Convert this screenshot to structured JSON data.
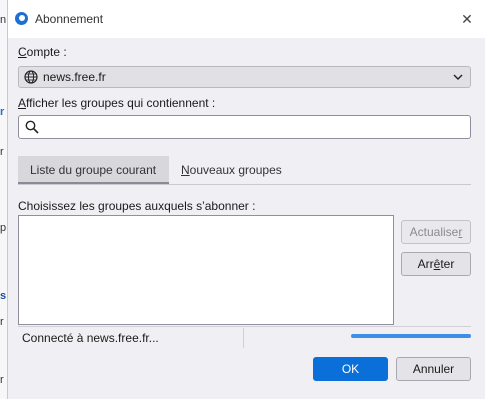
{
  "background_app": {
    "edge_chars": [
      "n",
      "r",
      "r",
      "p",
      "s",
      "r",
      "r"
    ]
  },
  "dialog": {
    "title": "Abonnement",
    "close_glyph": "✕"
  },
  "account": {
    "label": "Compte :",
    "selected": "news.free.fr"
  },
  "filter": {
    "label": "Afficher les groupes qui contiennent :",
    "value": "",
    "placeholder": ""
  },
  "tabs": [
    {
      "label": "Liste du groupe courant",
      "selected": true
    },
    {
      "label": "Nouveaux groupes",
      "selected": false
    }
  ],
  "list": {
    "label": "Choisissez les groupes auxquels s’abonner :"
  },
  "side_buttons": {
    "refresh": "Actualiser",
    "stop": "Arrêter"
  },
  "status": {
    "text": "Connecté à news.free.fr...",
    "progress": 1.0
  },
  "footer": {
    "ok": "OK",
    "cancel": "Annuler"
  },
  "colors": {
    "accent": "#0a6fd8",
    "progress": "#3d8ee8"
  }
}
